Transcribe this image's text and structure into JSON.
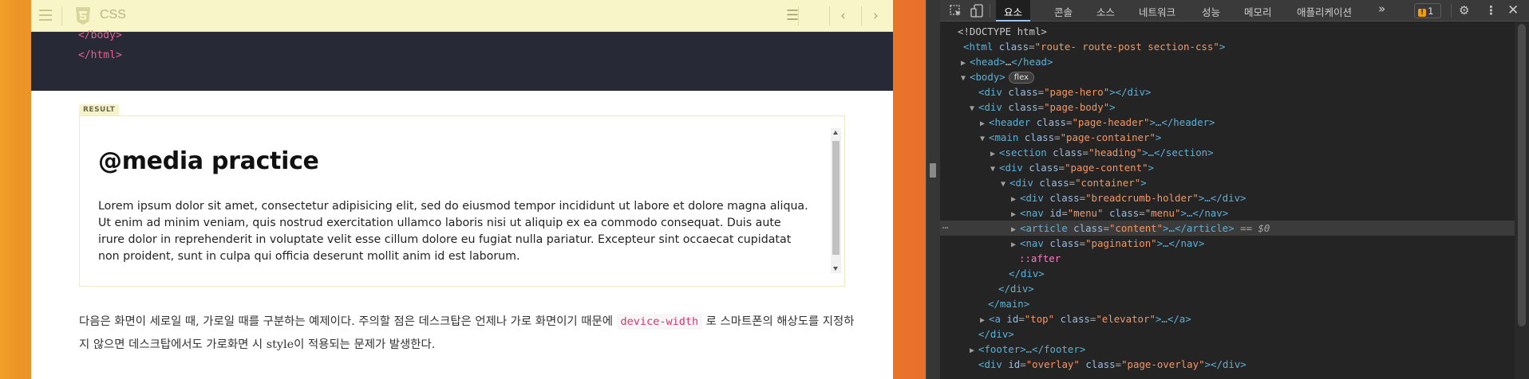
{
  "topbar": {
    "title": "CSS",
    "icons": [
      "menu-icon",
      "css3-icon",
      "toc-icon",
      "prev-icon",
      "next-icon"
    ]
  },
  "code": {
    "line1_open": "</",
    "line1_tag": "body",
    "line1_close": ">",
    "line2_open": "</",
    "line2_tag": "html",
    "line2_close": ">"
  },
  "result": {
    "tag": "RESULT",
    "heading": "@media practice",
    "paragraph": "Lorem ipsum dolor sit amet, consectetur adipisicing elit, sed do eiusmod tempor incididunt ut labore et dolore magna aliqua. Ut enim ad minim veniam, quis nostrud exercitation ullamco laboris nisi ut aliquip ex ea commodo consequat. Duis aute irure dolor in reprehenderit in voluptate velit esse cillum dolore eu fugiat nulla pariatur. Excepteur sint occaecat cupidatat non proident, sunt in culpa qui officia deserunt mollit anim id est laborum."
  },
  "description": {
    "before": "다음은 화면이 세로일 때, 가로일 때를 구분하는 예제이다. 주의할 점은 데스크탑은 언제나 가로 화면이기 때문에 ",
    "code": "device-width",
    "after": " 로 스마트폰의 해상도를 지정하지 않으면 데스크탑에서도 가로화면 시 style이 적용되는 문제가 발생한다."
  },
  "devtools": {
    "tabs": [
      "요소",
      "콘솔",
      "소스",
      "네트워크",
      "성능",
      "메모리",
      "애플리케이션"
    ],
    "more": "»",
    "issues_count": "1",
    "issues_icon": "!",
    "selected_marker": "== $0",
    "flex_badge": "flex",
    "dots": "⋯",
    "nodes": {
      "doctype": "<!DOCTYPE html>",
      "html_tag": "<html",
      "html_class_attr": "class",
      "html_class_val": "\"route- route-post section-css\"",
      "head": "<head>",
      "head_ell": "…",
      "head_end": "</head>",
      "body": "<body>",
      "pagehero_open": "<div",
      "pagehero_attr": "class",
      "pagehero_val": "\"page-hero\"",
      "pagehero_close": "></div>",
      "pagebody_open": "<div",
      "pagebody_attr": "class",
      "pagebody_val": "\"page-body\"",
      "pagebody_close": ">",
      "header_open": "<header",
      "header_attr": "class",
      "header_val": "\"page-header\"",
      "header_close": ">…</header>",
      "main_open": "<main",
      "main_attr": "class",
      "main_val": "\"page-container\"",
      "main_close": ">",
      "section_open": "<section",
      "section_attr": "class",
      "section_val": "\"heading\"",
      "section_close": ">…</section>",
      "pagecontent_open": "<div",
      "pagecontent_attr": "class",
      "pagecontent_val": "\"page-content\"",
      "pagecontent_close": ">",
      "container_open": "<div",
      "container_attr": "class",
      "container_val": "\"container\"",
      "container_close": ">",
      "breadcrumb_open": "<div",
      "breadcrumb_attr": "class",
      "breadcrumb_val": "\"breadcrumb-holder\"",
      "breadcrumb_close": ">…</div>",
      "nav_open": "<nav",
      "nav_id_attr": "id",
      "nav_id_val": "\"menu\"",
      "nav_attr": "class",
      "nav_val": "\"menu\"",
      "nav_close": ">…</nav>",
      "article_open": "<article",
      "article_attr": "class",
      "article_val": "\"content\"",
      "article_close": ">…</article>",
      "pag_open": "<nav",
      "pag_attr": "class",
      "pag_val": "\"pagination\"",
      "pag_close": ">…</nav>",
      "after": "::after",
      "div_end1": "</div>",
      "div_end2": "</div>",
      "main_end": "</main>",
      "a_open": "<a",
      "a_id_attr": "id",
      "a_id_val": "\"top\"",
      "a_attr": "class",
      "a_val": "\"elevator\"",
      "a_close": ">…</a>",
      "div_end3": "</div>",
      "footer": "<footer>…</footer>",
      "overlay_open": "<div",
      "overlay_id_attr": "id",
      "overlay_id_val": "\"overlay\"",
      "overlay_attr": "class",
      "overlay_val": "\"page-overlay\"",
      "overlay_close": "></div>"
    }
  }
}
